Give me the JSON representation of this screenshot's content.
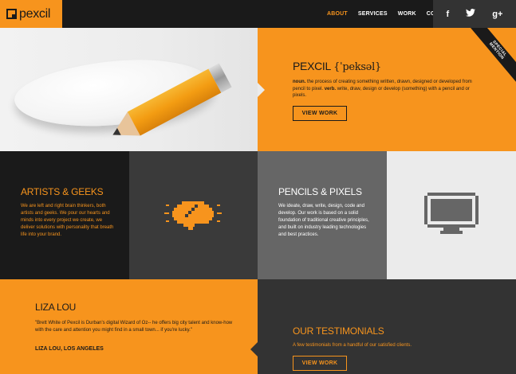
{
  "header": {
    "logo_text": "pexcil",
    "nav": [
      {
        "label": "ABOUT",
        "active": true
      },
      {
        "label": "SERVICES",
        "active": false
      },
      {
        "label": "WORK",
        "active": false
      },
      {
        "label": "CONTACT",
        "active": false
      }
    ],
    "social": [
      {
        "icon": "facebook-icon",
        "glyph": "f"
      },
      {
        "icon": "twitter-icon",
        "glyph": "t"
      },
      {
        "icon": "google-plus-icon",
        "glyph": "g+"
      }
    ]
  },
  "hero": {
    "title": "PEXCIL",
    "pronunciation": "{ˈpeksəl}",
    "definition_noun": "noun.",
    "definition_noun_text": "the process of creating something written, drawn, designed or developed from pencil to pixel.",
    "definition_verb": "verb.",
    "definition_verb_text": "write, draw, design or develop (something) with a pencil and or pixels.",
    "button": "VIEW WORK",
    "ribbon_line1": "SPECIAL",
    "ribbon_line2": "MENTION"
  },
  "artists": {
    "title": "ARTISTS & GEEKS",
    "body": "We are left and right brain thinkers, both artists and geeks. We pour our hearts and minds into every project we create, we deliver solutions with personality that breath life into your brand."
  },
  "pencils": {
    "title": "PENCILS & PIXELS",
    "body": "We ideate, draw, write, design, code and develop. Our work is based on a solid foundation of traditional creative principles, and built on industry leading technologies and best practices."
  },
  "testimonial": {
    "name": "LIZA LOU",
    "quote": "\"Brett White of Pexcil is Durban's digital Wizard of Oz-- he offers big city talent and know-how with the care and attention you might find in a small town... if you're lucky.\"",
    "cite": "LIZA LOU, LOS ANGELES"
  },
  "testimonials": {
    "title": "OUR TESTIMONIALS",
    "subtitle": "A few testimonials from a handful of our satisfied clients.",
    "button": "VIEW WORK"
  },
  "colors": {
    "accent": "#f7941d",
    "dark": "#1a1a1a",
    "mid": "#3a3a3a",
    "grey": "#666666",
    "light": "#ebebeb"
  }
}
